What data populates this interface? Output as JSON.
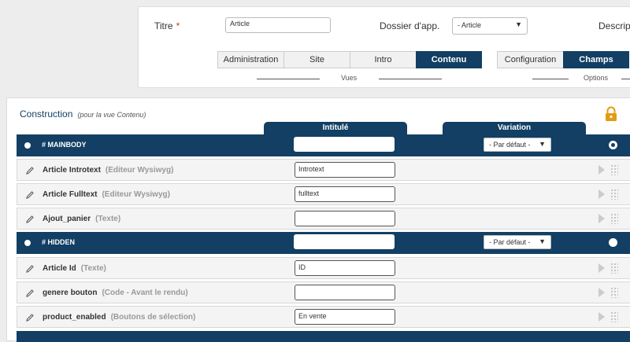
{
  "top": {
    "title_label": "Titre",
    "required_mark": "*",
    "title_value": "Article",
    "folder_label": "Dossier d'app.",
    "folder_value": "- Article",
    "folder_arrow": "▼",
    "desc_label": "Descript",
    "views_tabs": [
      {
        "label": "Administration",
        "active": false
      },
      {
        "label": "Site",
        "active": false
      },
      {
        "label": "Intro",
        "active": false
      },
      {
        "label": "Contenu",
        "active": true
      }
    ],
    "views_caption": "Vues",
    "options_tabs": [
      {
        "label": "Configuration",
        "active": false
      },
      {
        "label": "Champs",
        "active": true
      }
    ],
    "options_caption": "Options"
  },
  "construction": {
    "title": "Construction",
    "subtitle": "(pour la vue Contenu)",
    "col_intitule": "Intitulé",
    "col_variation": "Variation",
    "rows": [
      {
        "kind": "section",
        "name": "# MAINBODY",
        "value": "",
        "variation": "- Par défaut -",
        "arrow": "▼"
      },
      {
        "kind": "field",
        "name": "Article Introtext",
        "type": "(Editeur Wysiwyg)",
        "value": "Introtext"
      },
      {
        "kind": "field",
        "name": "Article Fulltext",
        "type": "(Editeur Wysiwyg)",
        "value": "fulltext"
      },
      {
        "kind": "field",
        "name": "Ajout_panier",
        "type": "(Texte)",
        "value": ""
      },
      {
        "kind": "section",
        "name": "# HIDDEN",
        "value": "",
        "variation": "- Par défaut -",
        "arrow": "▼"
      },
      {
        "kind": "field",
        "name": "Article Id",
        "type": "(Texte)",
        "value": "ID"
      },
      {
        "kind": "field",
        "name": "genere bouton",
        "type": "(Code - Avant le rendu)",
        "value": ""
      },
      {
        "kind": "field",
        "name": "product_enabled",
        "type": "(Boutons de sélection)",
        "value": "En vente"
      }
    ]
  },
  "colors": {
    "primary": "#123f63",
    "accent": "#e39c11",
    "required": "#c0392b"
  }
}
